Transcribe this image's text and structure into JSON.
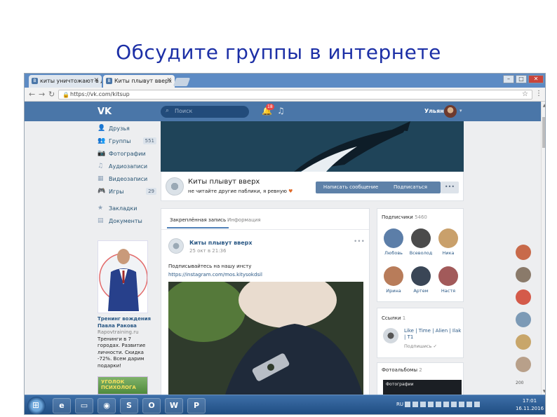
{
  "slide": {
    "title": "Обсудите группы в интернете"
  },
  "browser": {
    "tabs": [
      {
        "label": "киты уничтожают в дуэте",
        "active": false
      },
      {
        "label": "Киты плывут вверх",
        "active": true
      }
    ],
    "url": "https://vk.com/kitsup"
  },
  "vk": {
    "logo": "VK",
    "search_placeholder": "Поиск",
    "notifications_count": "18",
    "user_name": "Ульяна"
  },
  "left_menu": [
    {
      "icon": "friends-icon",
      "glyph": "👤",
      "label": "Друзья",
      "count": ""
    },
    {
      "icon": "groups-icon",
      "glyph": "👥",
      "label": "Группы",
      "count": "551"
    },
    {
      "icon": "photos-icon",
      "glyph": "📷",
      "label": "Фотографии",
      "count": ""
    },
    {
      "icon": "audio-icon",
      "glyph": "♫",
      "label": "Аудиозаписи",
      "count": ""
    },
    {
      "icon": "video-icon",
      "glyph": "▦",
      "label": "Видеозаписи",
      "count": ""
    },
    {
      "icon": "games-icon",
      "glyph": "🎮",
      "label": "Игры",
      "count": "29"
    }
  ],
  "left_menu_extra": [
    {
      "icon": "bookmarks-icon",
      "glyph": "★",
      "label": "Закладки"
    },
    {
      "icon": "documents-icon",
      "glyph": "▤",
      "label": "Документы"
    }
  ],
  "ad": {
    "title": "Тренинг вождения Павла Ракова",
    "site": "Rapovtraining.ru",
    "body": "Тренинги в 7 городах. Развитие личности. Скидка -72%. Всем дарим подарки!",
    "banner": "УГОЛОК ПСИХОЛОГА"
  },
  "group": {
    "name": "Киты плывут вверх",
    "status": "не читайте другие паблики, я ревную",
    "btn_message": "Написать сообщение",
    "btn_subscribe": "Подписаться",
    "btn_more": "•••"
  },
  "feed": {
    "tab_posts": "Закреплённая запись",
    "tab_info": "Информация",
    "post_author": "Киты плывут вверх",
    "post_date": "25 окт в 21:36",
    "post_text": "Подписывайтесь на нашу инсту",
    "post_link": "https://instagram.com/mos.kitysokdsil",
    "post_dots": "•••"
  },
  "subscribers": {
    "title": "Подписчики",
    "count": "5460",
    "people": [
      {
        "name": "Любовь",
        "color": "#5c7ea8"
      },
      {
        "name": "Всеволод",
        "color": "#4b4b4b"
      },
      {
        "name": "Ника",
        "color": "#c9a06b"
      },
      {
        "name": "Ирина",
        "color": "#b87c5a"
      },
      {
        "name": "Артем",
        "color": "#3a4656"
      },
      {
        "name": "Настя",
        "color": "#a25a5a"
      }
    ]
  },
  "links": {
    "title": "Ссылки",
    "count": "1",
    "name": "Like | Time | Alien | Ilak | Т1",
    "sub": "Подпишись ✓"
  },
  "albums": {
    "title": "Фотоальбомы",
    "count": "2",
    "thumb_label": "Фотографии"
  },
  "friends_strip": {
    "colors": [
      "#c86a4a",
      "#8a7a6a",
      "#d45a4a",
      "#7c9ab6",
      "#c8a66a",
      "#b8a08a"
    ],
    "label": "200"
  },
  "taskbar": {
    "apps": [
      {
        "icon": "ie-icon",
        "glyph": "e"
      },
      {
        "icon": "folder-icon",
        "glyph": "▭"
      },
      {
        "icon": "chrome-icon",
        "glyph": "◉"
      },
      {
        "icon": "skype-icon",
        "glyph": "S"
      },
      {
        "icon": "opera-icon",
        "glyph": "O"
      },
      {
        "icon": "word-icon",
        "glyph": "W"
      },
      {
        "icon": "powerpoint-icon",
        "glyph": "P"
      }
    ],
    "tray_lang": "RU",
    "time": "17:01",
    "date": "16.11.2016"
  }
}
